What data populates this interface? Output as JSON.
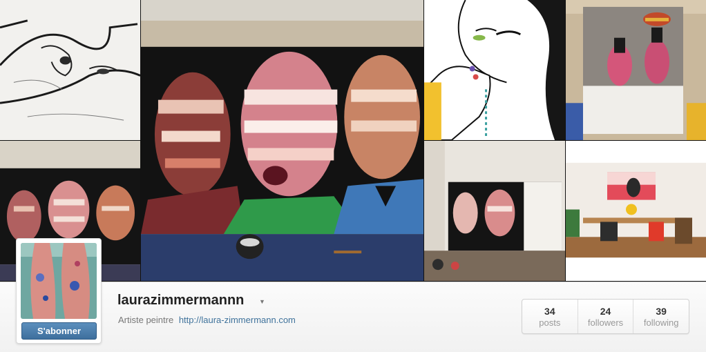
{
  "profile": {
    "username": "laurazimmermannn",
    "caret_icon": "caret-down-icon",
    "bio_text": "Artiste peintre",
    "bio_link": "http://laura-zimmermann.com",
    "follow_label": "S'abonner"
  },
  "stats": [
    {
      "value": "34",
      "label": "posts"
    },
    {
      "value": "24",
      "label": "followers"
    },
    {
      "value": "39",
      "label": "following"
    }
  ],
  "colors": {
    "follow_button": "#4a7aa8",
    "link": "#3f729b",
    "username": "#222222",
    "muted": "#999999"
  }
}
